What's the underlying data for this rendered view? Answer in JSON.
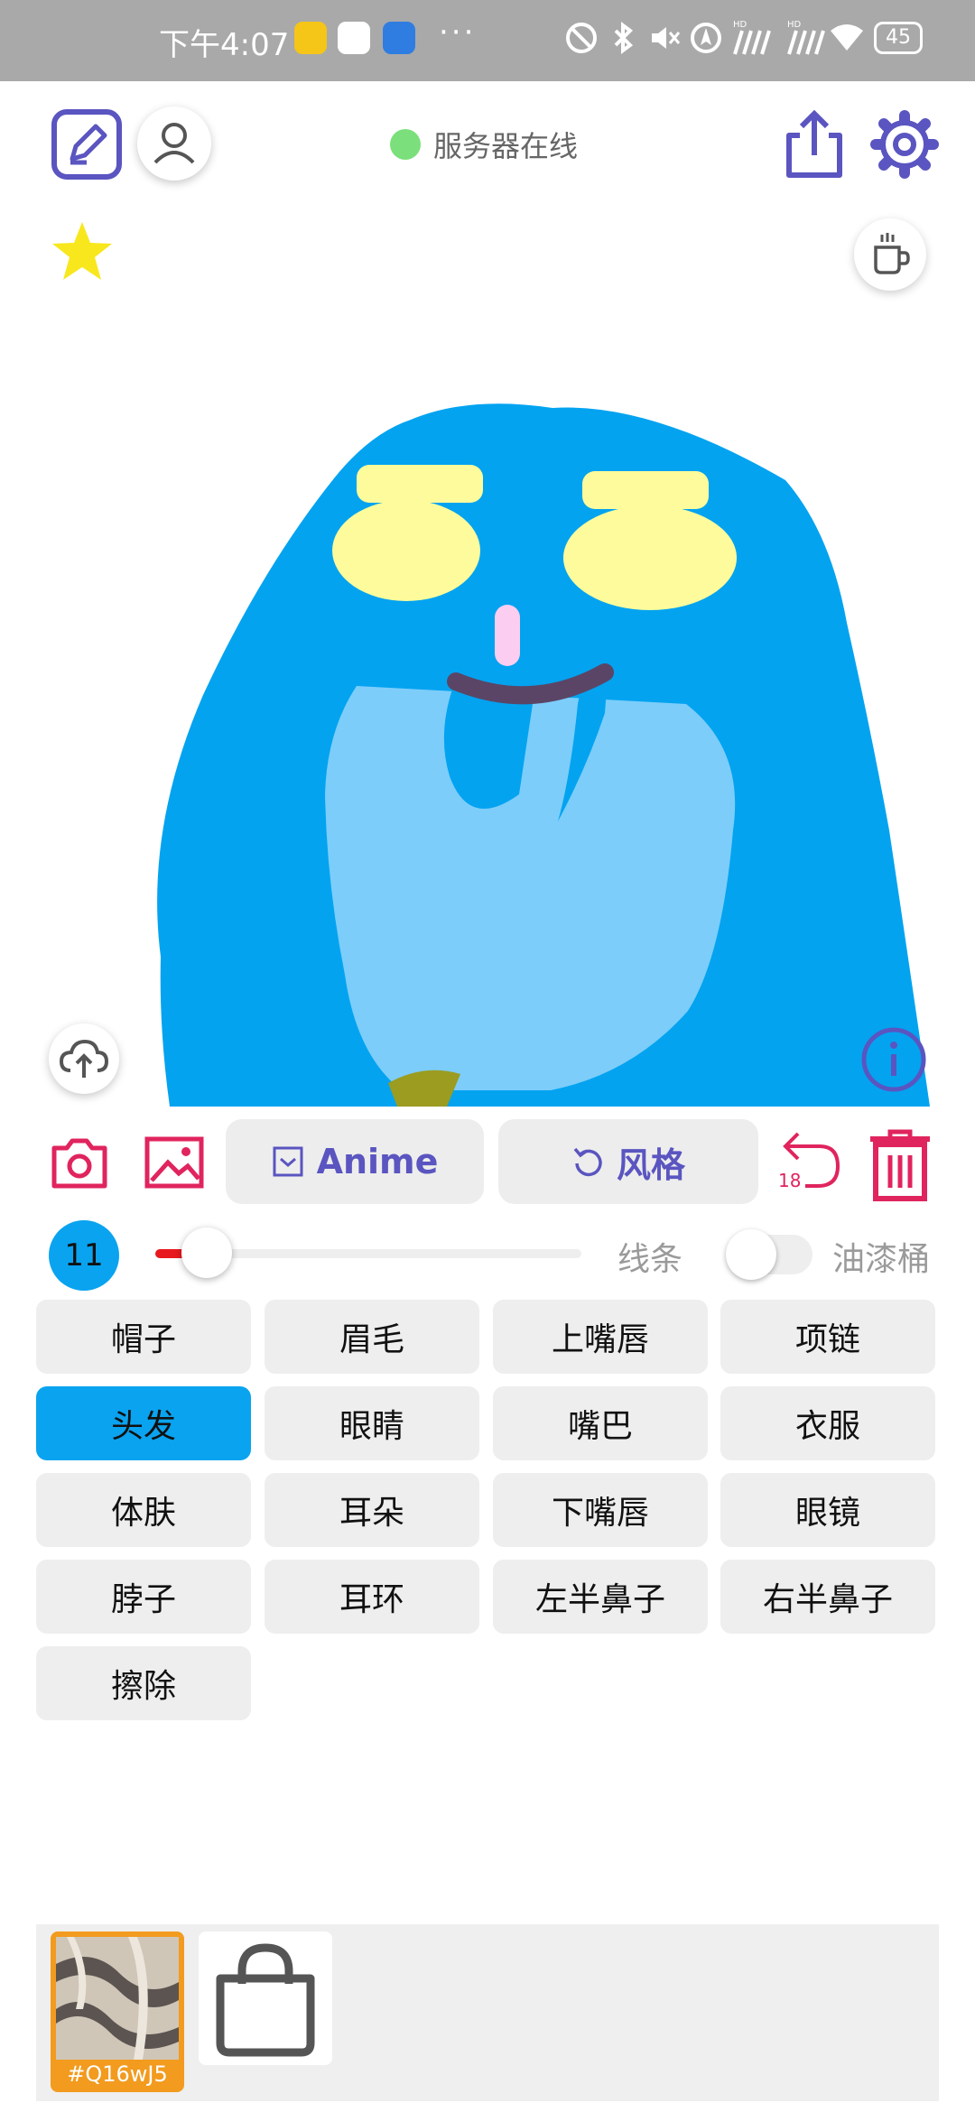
{
  "status_bar": {
    "time": "下午4:07",
    "more": "···",
    "battery": "45"
  },
  "header": {
    "server_status": "服务器在线"
  },
  "toolbar": {
    "anime_label": "Anime",
    "style_label": "风格",
    "undo_count": "18"
  },
  "brush": {
    "size": "11",
    "slider_fraction": 0.12,
    "line_label": "线条",
    "bucket_label": "油漆桶",
    "bucket_enabled": false
  },
  "parts": {
    "p0": "帽子",
    "p1": "眉毛",
    "p2": "上嘴唇",
    "p3": "项链",
    "p4": "头发",
    "p5": "眼睛",
    "p6": "嘴巴",
    "p7": "衣服",
    "p8": "体肤",
    "p9": "耳朵",
    "p10": "下嘴唇",
    "p11": "眼镜",
    "p12": "脖子",
    "p13": "耳环",
    "p14": "左半鼻子",
    "p15": "右半鼻子",
    "p16": "擦除",
    "selected": "头发"
  },
  "tray": {
    "thumb_code": "#Q16wJ5"
  },
  "colors": {
    "accent": "#5a55c0",
    "selected_part": "#0aa3f0",
    "danger": "#e0245e",
    "hair": "#03a3f0",
    "skin": "#7ccdfa",
    "eyes": "#fdfb9b"
  },
  "icons": [
    "edit-icon",
    "person-icon",
    "share-icon",
    "gear-icon",
    "star-icon",
    "coffee-cup-icon",
    "cloud-upload-icon",
    "info-icon",
    "camera-icon",
    "image-icon",
    "check-box-icon",
    "rotate-left-icon",
    "undo-icon",
    "trash-icon",
    "shopping-bag-icon"
  ]
}
